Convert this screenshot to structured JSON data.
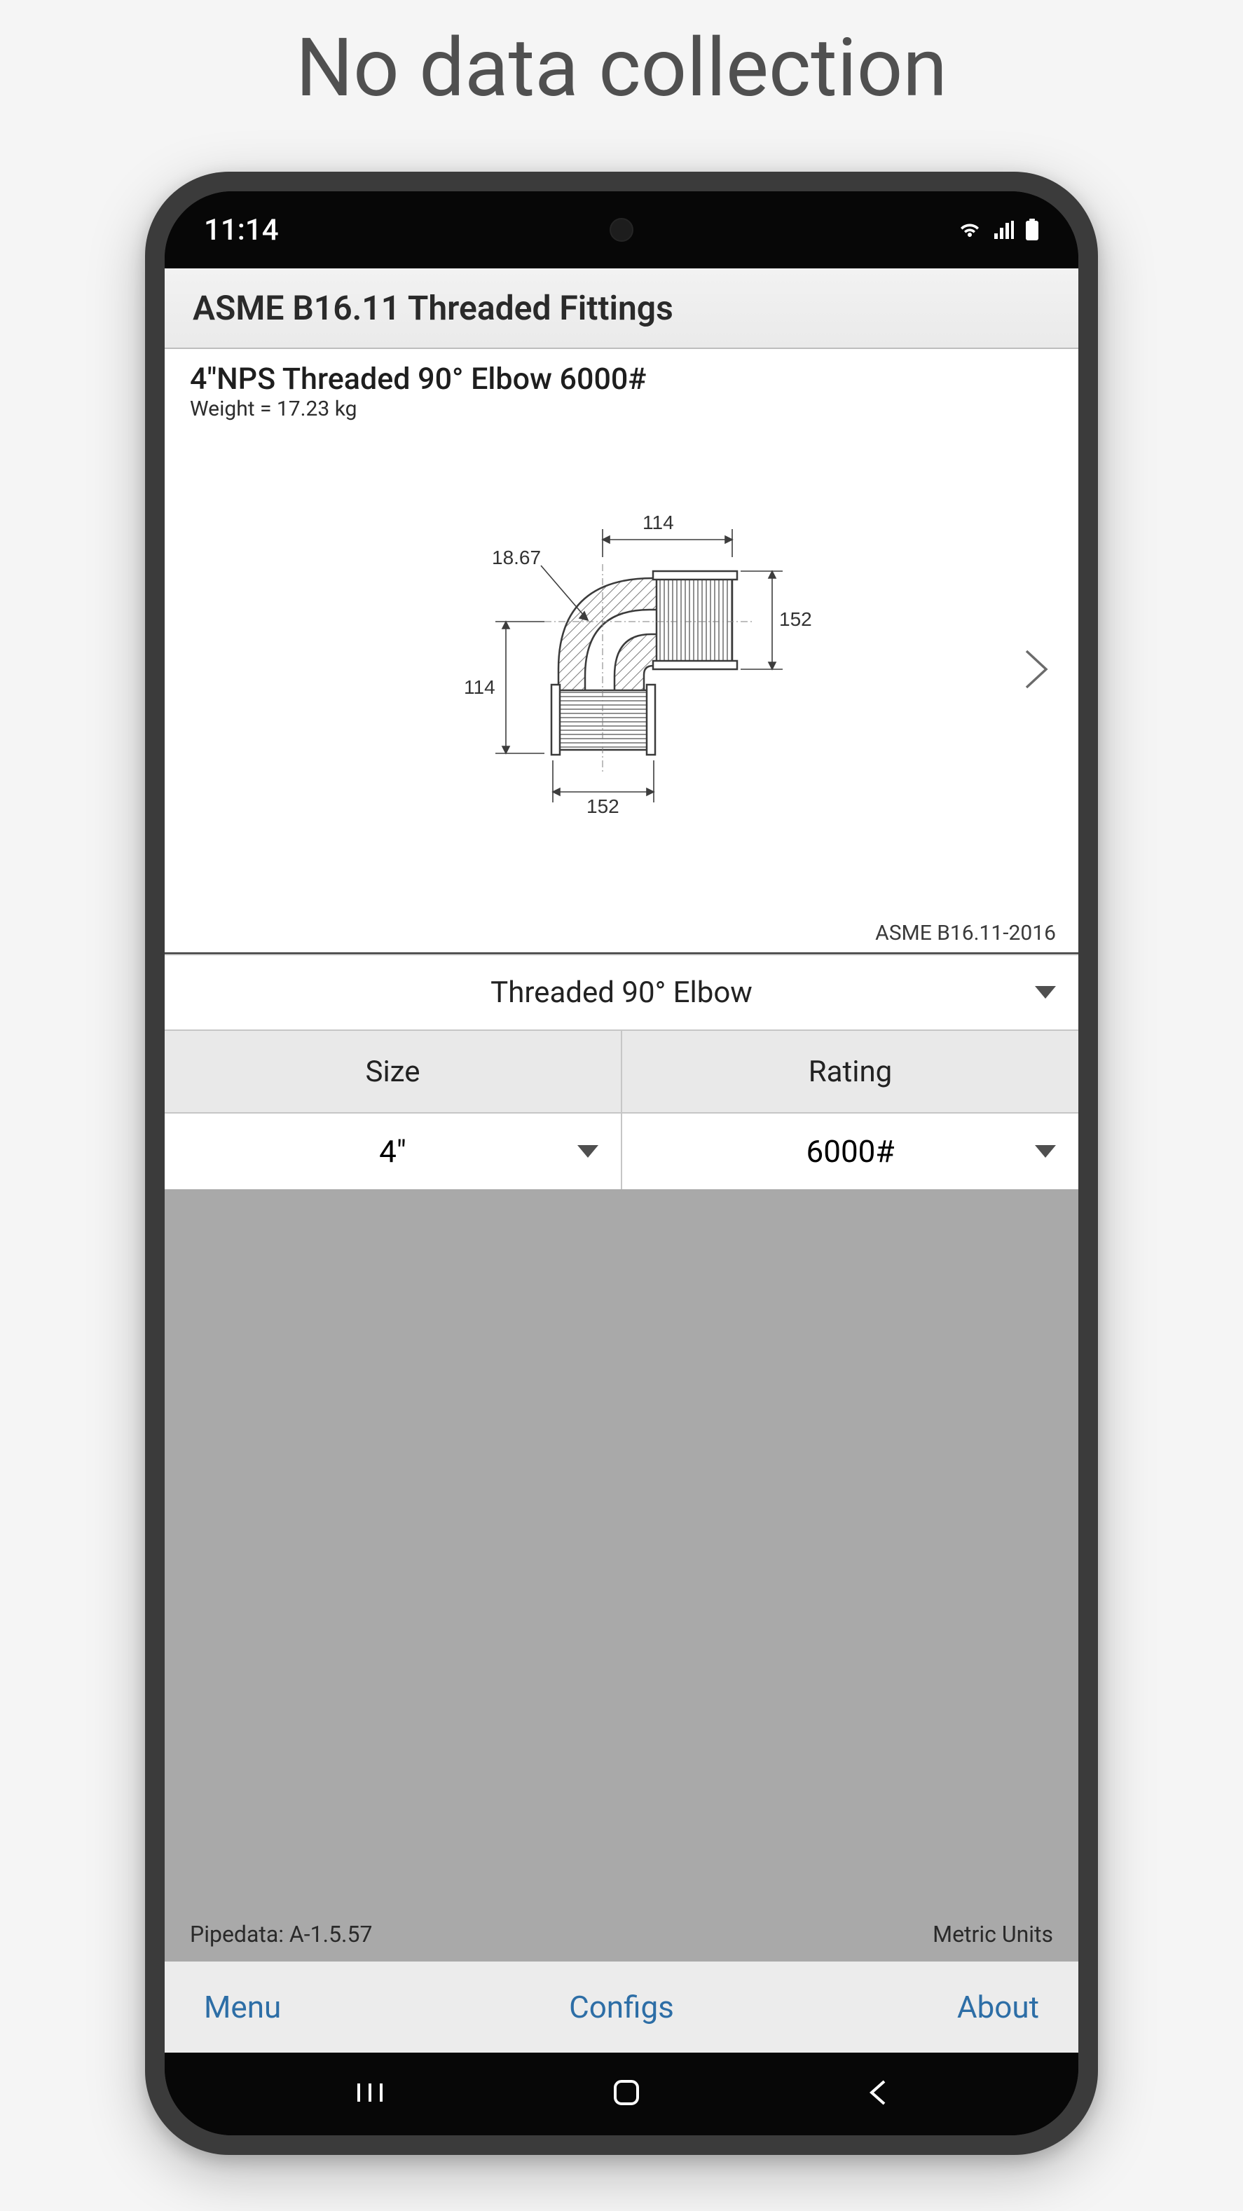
{
  "headline": "No data collection",
  "statusbar": {
    "time": "11:14"
  },
  "app": {
    "header_title": "ASME B16.11 Threaded Fittings"
  },
  "fitting": {
    "title": "4\"NPS Threaded 90° Elbow 6000#",
    "weight_line": "Weight = 17.23 kg",
    "spec": "ASME B16.11-2016"
  },
  "dimensions": {
    "top_width": "114",
    "fillet_radius": "18.67",
    "right_height": "152",
    "left_height": "114",
    "bottom_width": "152"
  },
  "selectors": {
    "type": {
      "label": "Threaded 90° Elbow"
    },
    "size": {
      "header": "Size",
      "value": "4\""
    },
    "rating": {
      "header": "Rating",
      "value": "6000#"
    }
  },
  "footer": {
    "pipedata": "Pipedata: A-1.5.57",
    "units": "Metric Units"
  },
  "tabs": {
    "menu": "Menu",
    "configs": "Configs",
    "about": "About"
  },
  "colors": {
    "link": "#2d6ea6"
  }
}
